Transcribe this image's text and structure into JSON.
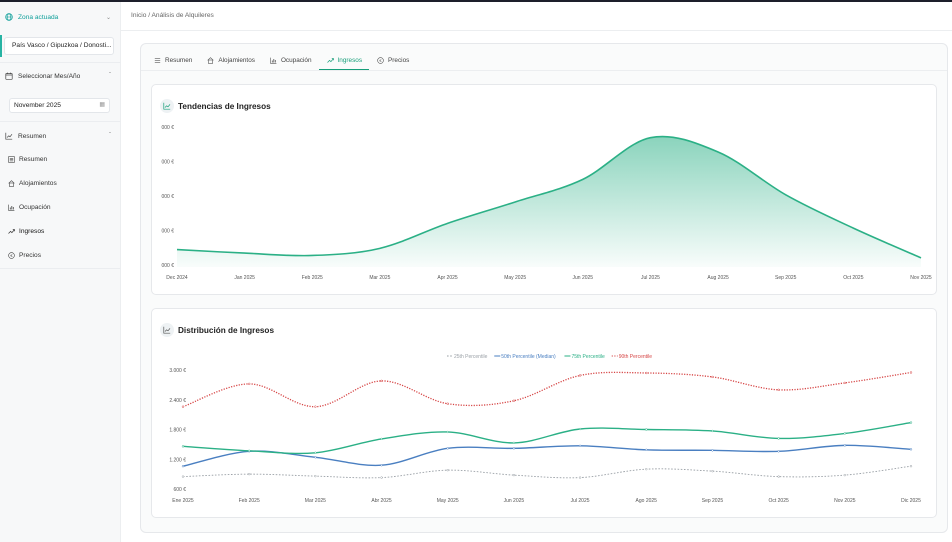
{
  "sidebar": {
    "zona_title": "Zona actuada",
    "zona_value": "País Vasco / Gipuzkoa / Donosti...",
    "mes_title": "Seleccionar Mes/Año",
    "date_value": "November 2025",
    "resumen_title": "Resumen",
    "items": [
      {
        "label": "Resumen",
        "icon": "list-icon"
      },
      {
        "label": "Alojamientos",
        "icon": "home-icon"
      },
      {
        "label": "Ocupación",
        "icon": "bar-chart-icon"
      },
      {
        "label": "Ingresos",
        "icon": "trending-up-icon"
      },
      {
        "label": "Precios",
        "icon": "euro-circle-icon"
      }
    ]
  },
  "breadcrumb": "Inicio  /  Análisis de Alquileres",
  "tabs": [
    {
      "label": "Resumen",
      "icon": "list-icon"
    },
    {
      "label": "Alojamientos",
      "icon": "home-icon"
    },
    {
      "label": "Ocupación",
      "icon": "bar-chart-icon"
    },
    {
      "label": "Ingresos",
      "icon": "trending-up-icon",
      "active": true
    },
    {
      "label": "Precios",
      "icon": "euro-circle-icon"
    }
  ],
  "colors": {
    "accent": "#179e7a",
    "p25": "#9aa0a6",
    "p50": "#4a7fc1",
    "p75": "#2bb086",
    "p90": "#d64545"
  },
  "chart_data": [
    {
      "type": "area",
      "title": "Tendencias de Ingresos",
      "categories": [
        "Dec 2024",
        "Jan 2025",
        "Feb 2025",
        "Mar 2025",
        "Apr 2025",
        "May 2025",
        "Jun 2025",
        "Jul 2025",
        "Aug 2025",
        "Sep 2025",
        "Oct 2025",
        "Nov 2025"
      ],
      "y_tick_labels": [
        "000 €",
        "000 €",
        "000 €",
        "000 €",
        "000 €"
      ],
      "values": [
        0.35,
        0.2,
        0.1,
        0.4,
        1.45,
        2.35,
        3.3,
        5.05,
        4.45,
        2.65,
        1.25,
        0.0
      ],
      "ylim": [
        -0.3,
        5.5
      ],
      "grid": false
    },
    {
      "type": "line",
      "title": "Distribución de Ingresos",
      "categories": [
        "Ene 2025",
        "Feb 2025",
        "Mar 2025",
        "Abr 2025",
        "May 2025",
        "Jun 2025",
        "Jul 2025",
        "Ago 2025",
        "Sep 2025",
        "Oct 2025",
        "Nov 2025",
        "Dic 2025"
      ],
      "y_ticks": [
        600,
        1200,
        1800,
        2400,
        3000
      ],
      "y_tick_labels": [
        "600 €",
        "1.200 €",
        "1.800 €",
        "2.400 €",
        "3.000 €"
      ],
      "ylim": [
        600,
        3000
      ],
      "legend_position": "top",
      "series": [
        {
          "name": "25th Percentile",
          "values": [
            850,
            900,
            860,
            830,
            980,
            880,
            830,
            1000,
            960,
            850,
            880,
            1060
          ]
        },
        {
          "name": "50th Percentile (Median)",
          "values": [
            1060,
            1360,
            1240,
            1080,
            1420,
            1420,
            1470,
            1390,
            1380,
            1360,
            1480,
            1400
          ]
        },
        {
          "name": "75th Percentile",
          "values": [
            1460,
            1370,
            1330,
            1610,
            1750,
            1530,
            1810,
            1800,
            1770,
            1620,
            1720,
            1940
          ]
        },
        {
          "name": "90th Percentile",
          "values": [
            2260,
            2720,
            2260,
            2780,
            2320,
            2380,
            2890,
            2940,
            2860,
            2600,
            2740,
            2950
          ]
        }
      ]
    }
  ]
}
